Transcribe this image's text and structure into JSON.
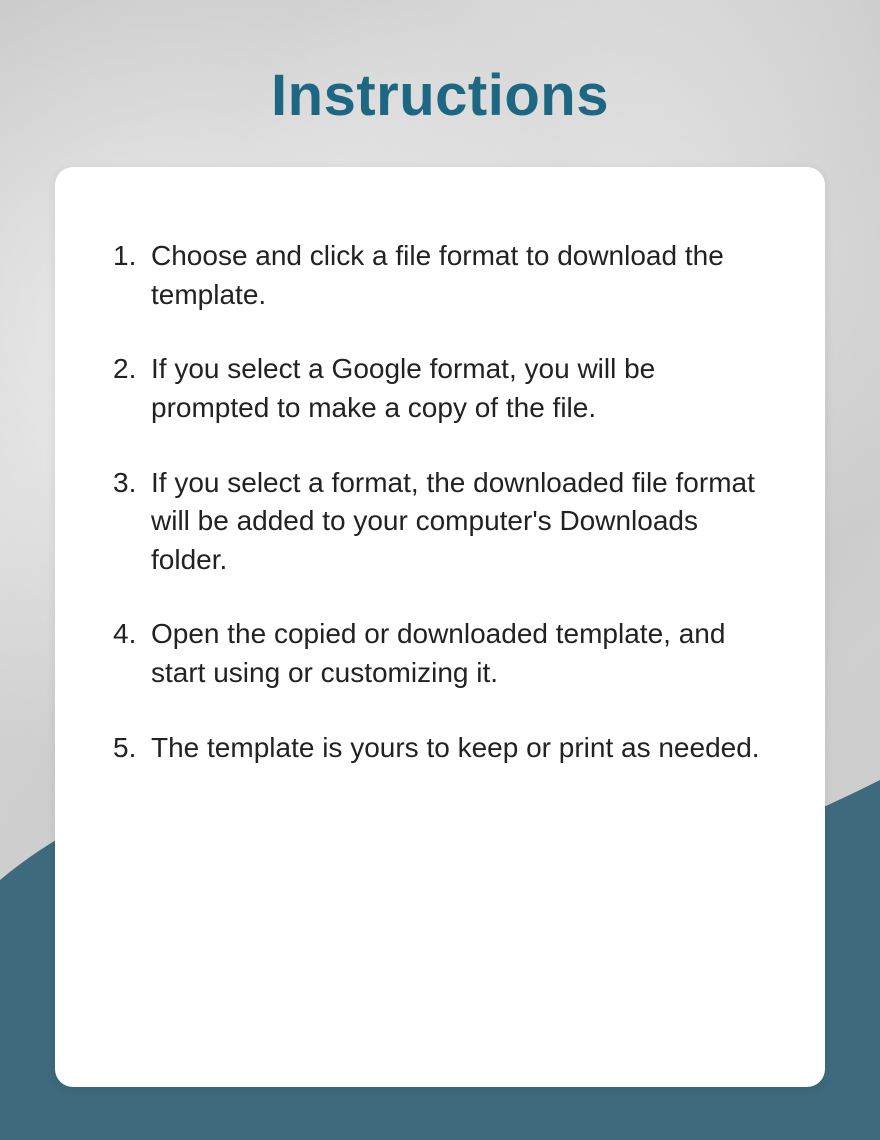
{
  "title": "Instructions",
  "colors": {
    "accent": "#1d6783",
    "wave": "#3d6a7c",
    "card": "#ffffff"
  },
  "steps": [
    "Choose and click a file format to download the template.",
    "If you select a Google format, you will be prompted to make a copy of the file.",
    "If you select a format, the downloaded file format will be added to your computer's Downloads folder.",
    "Open the copied or downloaded template, and start using or customizing it.",
    "The template is yours to keep or print as needed."
  ]
}
